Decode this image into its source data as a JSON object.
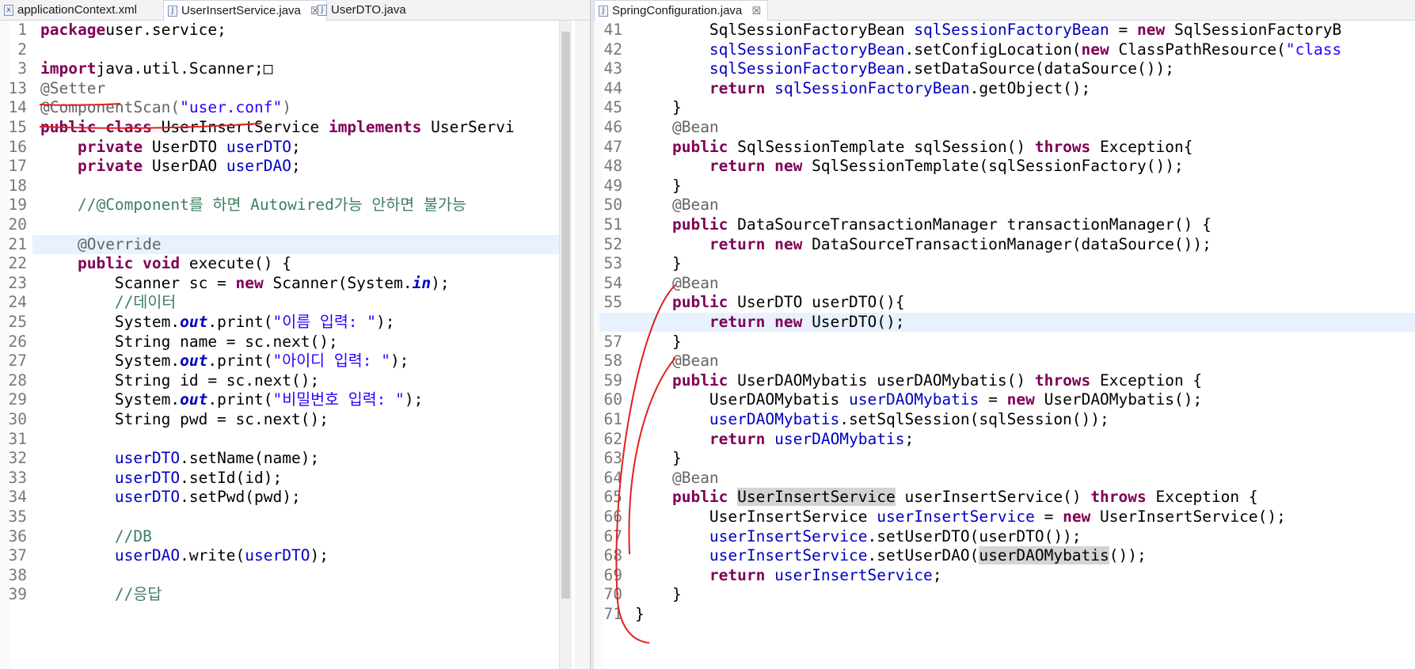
{
  "left_editor": {
    "tabs": [
      {
        "label": "applicationContext.xml",
        "active": false
      },
      {
        "label": "UserInsertService.java",
        "active": true,
        "close": "☒"
      },
      {
        "label": "UserDTO.java",
        "active": false
      }
    ],
    "line_numbers": [
      "1",
      "2",
      "3",
      "13",
      "14",
      "15",
      "16",
      "17",
      "18",
      "19",
      "20",
      "21",
      "22",
      "23",
      "24",
      "25",
      "26",
      "27",
      "28",
      "29",
      "30",
      "31",
      "32",
      "33",
      "34",
      "35",
      "36",
      "37",
      "38",
      "39"
    ],
    "lines": [
      [
        [
          "kw",
          "package"
        ],
        [
          "",
          "user.service;"
        ]
      ],
      [],
      [
        [
          "kw",
          "import"
        ],
        [
          "",
          "java.util.Scanner;"
        ],
        [
          "",
          "□"
        ]
      ],
      [
        [
          "ann",
          "@Setter"
        ]
      ],
      [
        [
          "ann",
          "@ComponentScan("
        ],
        [
          "str",
          "\"user.conf\""
        ],
        [
          "ann",
          ")"
        ]
      ],
      [
        [
          "kw",
          "public class"
        ],
        [
          "",
          " UserInsertService "
        ],
        [
          "kw",
          "implements"
        ],
        [
          "",
          " UserServi"
        ]
      ],
      [
        [
          "",
          "    "
        ],
        [
          "kw",
          "private"
        ],
        [
          "",
          " UserDTO "
        ],
        [
          "fld",
          "userDTO"
        ],
        [
          "",
          ";"
        ]
      ],
      [
        [
          "",
          "    "
        ],
        [
          "kw",
          "private"
        ],
        [
          "",
          " UserDAO "
        ],
        [
          "fld",
          "userDAO"
        ],
        [
          "",
          ";"
        ]
      ],
      [],
      [
        [
          "",
          "    "
        ],
        [
          "cmt",
          "//@Component를 하면 Autowired가능 안하면 불가능"
        ]
      ],
      [],
      [
        [
          "",
          "    "
        ],
        [
          "ann",
          "@Override"
        ]
      ],
      [
        [
          "",
          "    "
        ],
        [
          "kw",
          "public void"
        ],
        [
          "",
          " execute() {"
        ]
      ],
      [
        [
          "",
          "        Scanner sc = "
        ],
        [
          "kw",
          "new"
        ],
        [
          "",
          " Scanner(System."
        ],
        [
          "sfld",
          "in"
        ],
        [
          "",
          ");"
        ]
      ],
      [
        [
          "",
          "        "
        ],
        [
          "cmt",
          "//데이터"
        ]
      ],
      [
        [
          "",
          "        System."
        ],
        [
          "sfld",
          "out"
        ],
        [
          "",
          ".print("
        ],
        [
          "str",
          "\"이름 입력: \""
        ],
        [
          "",
          ");"
        ]
      ],
      [
        [
          "",
          "        String name = sc.next();"
        ]
      ],
      [
        [
          "",
          "        System."
        ],
        [
          "sfld",
          "out"
        ],
        [
          "",
          ".print("
        ],
        [
          "str",
          "\"아이디 입력: \""
        ],
        [
          "",
          ");"
        ]
      ],
      [
        [
          "",
          "        String id = sc.next();"
        ]
      ],
      [
        [
          "",
          "        System."
        ],
        [
          "sfld",
          "out"
        ],
        [
          "",
          ".print("
        ],
        [
          "str",
          "\"비밀번호 입력: \""
        ],
        [
          "",
          ");"
        ]
      ],
      [
        [
          "",
          "        String pwd = sc.next();"
        ]
      ],
      [],
      [
        [
          "",
          "        "
        ],
        [
          "fld",
          "userDTO"
        ],
        [
          "",
          ".setName(name);"
        ]
      ],
      [
        [
          "",
          "        "
        ],
        [
          "fld",
          "userDTO"
        ],
        [
          "",
          ".setId(id);"
        ]
      ],
      [
        [
          "",
          "        "
        ],
        [
          "fld",
          "userDTO"
        ],
        [
          "",
          ".setPwd(pwd);"
        ]
      ],
      [],
      [
        [
          "",
          "        "
        ],
        [
          "cmt",
          "//DB"
        ]
      ],
      [
        [
          "",
          "        "
        ],
        [
          "fld",
          "userDAO"
        ],
        [
          "",
          ".write("
        ],
        [
          "fld",
          "userDTO"
        ],
        [
          "",
          ");"
        ]
      ],
      [],
      [
        [
          "",
          "        "
        ],
        [
          "cmt",
          "//응답"
        ]
      ]
    ]
  },
  "right_editor": {
    "tabs": [
      {
        "label": "SpringConfiguration.java",
        "active": true,
        "close": "☒"
      }
    ],
    "line_numbers": [
      "41",
      "42",
      "43",
      "44",
      "45",
      "46",
      "47",
      "48",
      "49",
      "50",
      "51",
      "52",
      "53",
      "54",
      "55",
      "56",
      "57",
      "58",
      "59",
      "60",
      "61",
      "62",
      "63",
      "64",
      "65",
      "66",
      "67",
      "68",
      "69",
      "70",
      "71"
    ],
    "lines": [
      [
        [
          "",
          "        SqlSessionFactoryBean "
        ],
        [
          "fld",
          "sqlSessionFactoryBean"
        ],
        [
          "",
          " = "
        ],
        [
          "kw",
          "new"
        ],
        [
          "",
          " SqlSessionFactoryB"
        ]
      ],
      [
        [
          "",
          "        "
        ],
        [
          "fld",
          "sqlSessionFactoryBean"
        ],
        [
          "",
          ".setConfigLocation("
        ],
        [
          "kw",
          "new"
        ],
        [
          "",
          " ClassPathResource("
        ],
        [
          "str",
          "\"class"
        ]
      ],
      [
        [
          "",
          "        "
        ],
        [
          "fld",
          "sqlSessionFactoryBean"
        ],
        [
          "",
          ".setDataSource(dataSource());"
        ]
      ],
      [
        [
          "",
          "        "
        ],
        [
          "kw",
          "return"
        ],
        [
          "",
          " "
        ],
        [
          "fld",
          "sqlSessionFactoryBean"
        ],
        [
          "",
          ".getObject();"
        ]
      ],
      [
        [
          "",
          "    }"
        ]
      ],
      [
        [
          "",
          "    "
        ],
        [
          "ann",
          "@Bean"
        ]
      ],
      [
        [
          "",
          "    "
        ],
        [
          "kw",
          "public"
        ],
        [
          "",
          " SqlSessionTemplate sqlSession() "
        ],
        [
          "kw",
          "throws"
        ],
        [
          "",
          " Exception{"
        ]
      ],
      [
        [
          "",
          "        "
        ],
        [
          "kw",
          "return new"
        ],
        [
          "",
          " SqlSessionTemplate(sqlSessionFactory());"
        ]
      ],
      [
        [
          "",
          "    }"
        ]
      ],
      [
        [
          "",
          "    "
        ],
        [
          "ann",
          "@Bean"
        ]
      ],
      [
        [
          "",
          "    "
        ],
        [
          "kw",
          "public"
        ],
        [
          "",
          " DataSourceTransactionManager transactionManager() {"
        ]
      ],
      [
        [
          "",
          "        "
        ],
        [
          "kw",
          "return new"
        ],
        [
          "",
          " DataSourceTransactionManager(dataSource());"
        ]
      ],
      [
        [
          "",
          "    }"
        ]
      ],
      [
        [
          "",
          "    "
        ],
        [
          "ann",
          "@Bean"
        ]
      ],
      [
        [
          "",
          "    "
        ],
        [
          "kw",
          "public"
        ],
        [
          "",
          " UserDTO userDTO(){"
        ]
      ],
      [
        [
          "",
          "        "
        ],
        [
          "kw",
          "return new"
        ],
        [
          "",
          " UserDTO();"
        ]
      ],
      [
        [
          "",
          "    }"
        ]
      ],
      [
        [
          "",
          "    "
        ],
        [
          "ann",
          "@Bean"
        ]
      ],
      [
        [
          "",
          "    "
        ],
        [
          "kw",
          "public"
        ],
        [
          "",
          " UserDAOMybatis userDAOMybatis() "
        ],
        [
          "kw",
          "throws"
        ],
        [
          "",
          " Exception {"
        ]
      ],
      [
        [
          "",
          "        UserDAOMybatis "
        ],
        [
          "fld",
          "userDAOMybatis"
        ],
        [
          "",
          " = "
        ],
        [
          "kw",
          "new"
        ],
        [
          "",
          " UserDAOMybatis();"
        ]
      ],
      [
        [
          "",
          "        "
        ],
        [
          "fld",
          "userDAOMybatis"
        ],
        [
          "",
          ".setSqlSession(sqlSession());"
        ]
      ],
      [
        [
          "",
          "        "
        ],
        [
          "kw",
          "return"
        ],
        [
          "",
          " "
        ],
        [
          "fld",
          "userDAOMybatis"
        ],
        [
          "",
          ";"
        ]
      ],
      [
        [
          "",
          "    }"
        ]
      ],
      [
        [
          "",
          "    "
        ],
        [
          "ann",
          "@Bean"
        ]
      ],
      [
        [
          "",
          "    "
        ],
        [
          "kw",
          "public"
        ],
        [
          "",
          " "
        ],
        [
          "sel",
          "UserInsertService"
        ],
        [
          "",
          " userInsertService() "
        ],
        [
          "kw",
          "throws"
        ],
        [
          "",
          " Exception {"
        ]
      ],
      [
        [
          "",
          "        UserInsertService "
        ],
        [
          "fld",
          "userInsertService"
        ],
        [
          "",
          " = "
        ],
        [
          "kw",
          "new"
        ],
        [
          "",
          " UserInsertService();"
        ]
      ],
      [
        [
          "",
          "        "
        ],
        [
          "fld",
          "userInsertService"
        ],
        [
          "",
          ".setUserDTO(userDTO());"
        ]
      ],
      [
        [
          "",
          "        "
        ],
        [
          "fld",
          "userInsertService"
        ],
        [
          "",
          ".setUserDAO("
        ],
        [
          "sel",
          "userDAOMybatis"
        ],
        [
          "",
          "());"
        ]
      ],
      [
        [
          "",
          "        "
        ],
        [
          "kw",
          "return"
        ],
        [
          "",
          " "
        ],
        [
          "fld",
          "userInsertService"
        ],
        [
          "",
          ";"
        ]
      ],
      [
        [
          "",
          "    }"
        ]
      ],
      [
        [
          "",
          "}"
        ]
      ]
    ]
  }
}
